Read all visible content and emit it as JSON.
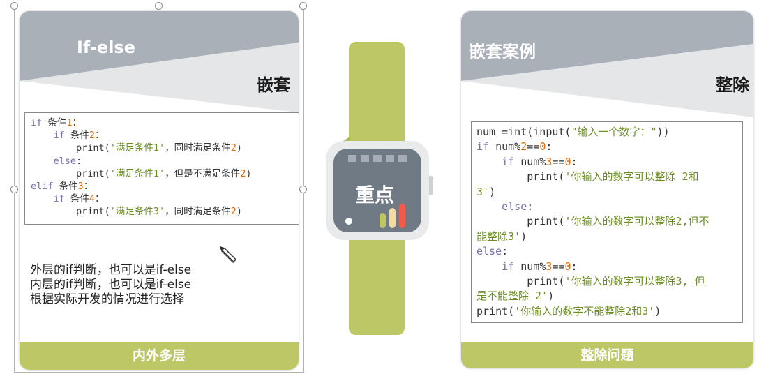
{
  "colors": {
    "banner_gray": "#a9b0b8",
    "banner_light": "#e4e6e8",
    "accent_green": "#bdc765",
    "watch_screen": "#6f7a84",
    "keyword": "#7a6fa8",
    "number": "#e06c0a",
    "string": "#6b8e23"
  },
  "left_card": {
    "title": "If-else",
    "subtitle": "嵌套",
    "code": [
      [
        [
          "kw",
          "if "
        ],
        [
          "plain",
          "条件"
        ],
        [
          "num",
          "1"
        ],
        [
          "plain",
          "："
        ]
      ],
      [
        [
          "plain",
          "    "
        ],
        [
          "kw",
          "if "
        ],
        [
          "plain",
          "条件"
        ],
        [
          "num",
          "2"
        ],
        [
          "plain",
          "："
        ]
      ],
      [
        [
          "plain",
          "        print("
        ],
        [
          "str",
          "'满足条件1'"
        ],
        [
          "plain",
          "，同时满足条件"
        ],
        [
          "num",
          "2"
        ],
        [
          "plain",
          ")"
        ]
      ],
      [
        [
          "plain",
          "    "
        ],
        [
          "kw",
          "else"
        ],
        [
          "plain",
          ":"
        ]
      ],
      [
        [
          "plain",
          "        print("
        ],
        [
          "str",
          "'满足条件1'"
        ],
        [
          "plain",
          "，但是不满足条件"
        ],
        [
          "num",
          "2"
        ],
        [
          "plain",
          ")"
        ]
      ],
      [
        [
          "kw",
          "elif "
        ],
        [
          "plain",
          "条件"
        ],
        [
          "num",
          "3"
        ],
        [
          "plain",
          "："
        ]
      ],
      [
        [
          "plain",
          "    "
        ],
        [
          "kw",
          "if "
        ],
        [
          "plain",
          "条件"
        ],
        [
          "num",
          "4"
        ],
        [
          "plain",
          "："
        ]
      ],
      [
        [
          "plain",
          "        print("
        ],
        [
          "str",
          "'满足条件3'"
        ],
        [
          "plain",
          "，同时满足条件"
        ],
        [
          "num",
          "2"
        ],
        [
          "plain",
          ")"
        ]
      ]
    ],
    "notes": [
      "外层的if判断，也可以是if-else",
      "内层的if判断，也可以是if-else",
      "根据实际开发的情况进行选择"
    ],
    "footer": "内外多层"
  },
  "watch": {
    "label": "重点",
    "icon": "smartwatch-icon"
  },
  "right_card": {
    "title": "嵌套案例",
    "subtitle": "整除",
    "code": [
      [
        [
          "plain",
          "num =int(input("
        ],
        [
          "str",
          "\"输入一个数字：\""
        ],
        [
          "plain",
          "))"
        ]
      ],
      [
        [
          "kw",
          "if "
        ],
        [
          "plain",
          "num%"
        ],
        [
          "num",
          "2"
        ],
        [
          "plain",
          "=="
        ],
        [
          "num",
          "0"
        ],
        [
          "plain",
          ":"
        ]
      ],
      [
        [
          "plain",
          "    "
        ],
        [
          "kw",
          "if "
        ],
        [
          "plain",
          "num%"
        ],
        [
          "num",
          "3"
        ],
        [
          "plain",
          "=="
        ],
        [
          "num",
          "0"
        ],
        [
          "plain",
          ":"
        ]
      ],
      [
        [
          "plain",
          "        print("
        ],
        [
          "str",
          "'你输入的数字可以整除 2和"
        ]
      ],
      [
        [
          "str",
          "3'"
        ],
        [
          "plain",
          ")"
        ]
      ],
      [
        [
          "plain",
          "    "
        ],
        [
          "kw",
          "else"
        ],
        [
          "plain",
          ":"
        ]
      ],
      [
        [
          "plain",
          "        print("
        ],
        [
          "str",
          "'你输入的数字可以整除2,但不"
        ]
      ],
      [
        [
          "str",
          "能整除3'"
        ],
        [
          "plain",
          ")"
        ]
      ],
      [
        [
          "kw",
          "else"
        ],
        [
          "plain",
          ":"
        ]
      ],
      [
        [
          "plain",
          "    "
        ],
        [
          "kw",
          "if "
        ],
        [
          "plain",
          "num%"
        ],
        [
          "num",
          "3"
        ],
        [
          "plain",
          "=="
        ],
        [
          "num",
          "0"
        ],
        [
          "plain",
          ":"
        ]
      ],
      [
        [
          "plain",
          "        print("
        ],
        [
          "str",
          "'你输入的数字可以整除3, 但"
        ]
      ],
      [
        [
          "str",
          "是不能整除 2'"
        ],
        [
          "plain",
          ")"
        ]
      ],
      [
        [
          "plain",
          "print("
        ],
        [
          "str",
          "'你输入的数字不能整除2和3'"
        ],
        [
          "plain",
          ")"
        ]
      ]
    ],
    "footer": "整除问题"
  },
  "cursor": {
    "icon": "pencil-cursor-icon"
  },
  "selection": {
    "icon": "selection-handle-icon"
  }
}
